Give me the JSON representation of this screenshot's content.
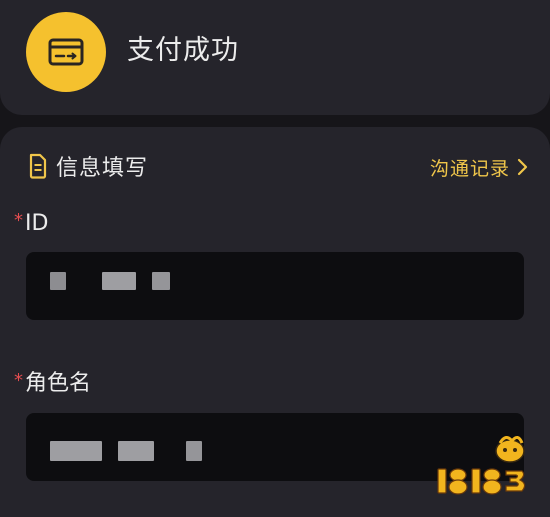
{
  "status": {
    "title": "支付成功",
    "icon": "payment-card-icon",
    "icon_color": "#f5c12e"
  },
  "form": {
    "section_title": "信息填写",
    "section_icon": "document-icon",
    "chat_log_link": "沟通记录",
    "accent_color": "#f0c64a",
    "fields": [
      {
        "label": "ID",
        "required": true,
        "required_mark": "*",
        "value_masked": true
      },
      {
        "label": "角色名",
        "required": true,
        "required_mark": "*",
        "value_masked": true
      }
    ]
  },
  "watermark": {
    "text": "18183"
  }
}
